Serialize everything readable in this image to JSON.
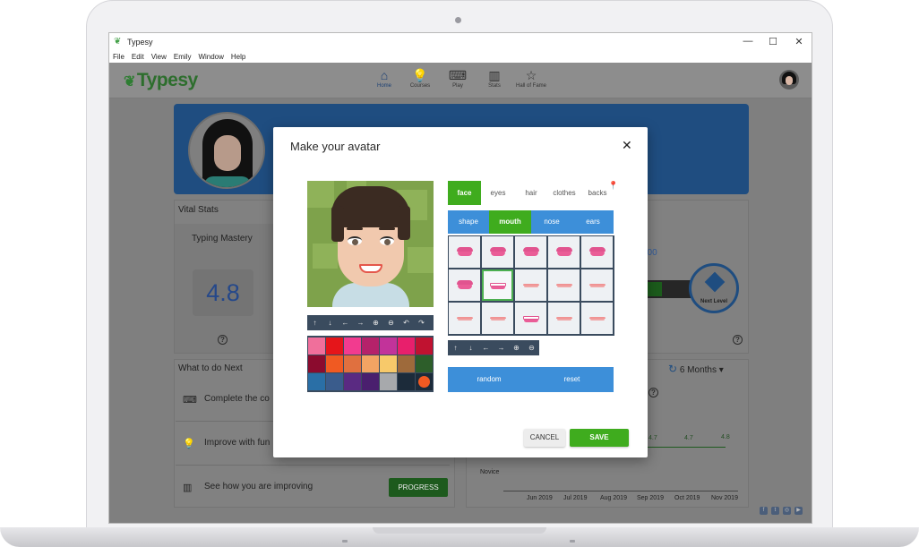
{
  "window": {
    "title": "Typesy",
    "minimize": "—",
    "maximize": "☐",
    "close": "✕"
  },
  "menu": [
    "File",
    "Edit",
    "View",
    "Emily",
    "Window",
    "Help"
  ],
  "app": {
    "logo": "Typesy"
  },
  "nav": [
    {
      "label": "Home",
      "icon": "⌂",
      "active": true
    },
    {
      "label": "Courses",
      "icon": "💡"
    },
    {
      "label": "Play",
      "icon": "⌨"
    },
    {
      "label": "Stats",
      "icon": "▥"
    },
    {
      "label": "Hall of Fame",
      "icon": "☆"
    }
  ],
  "dashboard": {
    "vital_stats_title": "Vital Stats",
    "typing_mastery_label": "Typing Mastery",
    "typing_mastery_value": "4.8",
    "level_value_partial": "000",
    "next_level_label": "Next Level",
    "what_next_title": "What to do Next",
    "todo": [
      {
        "icon": "⌨",
        "text": "Complete the co"
      },
      {
        "icon": "💡",
        "text": "Improve with fun"
      },
      {
        "icon": "▥",
        "text": "See how you are improving"
      }
    ],
    "progress_button": "PROGRESS",
    "months_filter": "6 Months",
    "chart_novice_label": "Novice",
    "chart_values": [
      "4.7",
      "4.7",
      "4.8"
    ],
    "months": [
      "Jun 2019",
      "Jul 2019",
      "Aug 2019",
      "Sep 2019",
      "Oct 2019",
      "Nov 2019"
    ]
  },
  "modal": {
    "title": "Make your avatar",
    "close": "✕",
    "tabs": [
      "face",
      "eyes",
      "hair",
      "clothes",
      "backs"
    ],
    "active_tab": "face",
    "subtabs": [
      "shape",
      "mouth",
      "nose",
      "ears"
    ],
    "active_subtab": "mouth",
    "avatar_tools": [
      "↑",
      "↓",
      "←",
      "→",
      "⊕",
      "⊖",
      "↶",
      "↷"
    ],
    "feature_tools": [
      "↑",
      "↓",
      "←",
      "→",
      "⊕",
      "⊖"
    ],
    "palette": [
      "#f06f9b",
      "#e5151a",
      "#f23b8f",
      "#b5226a",
      "#c2339a",
      "#e81f6c",
      "#c01230",
      "#8b0b2e",
      "#f05a22",
      "#e0703f",
      "#f2a463",
      "#f7c96a",
      "#9e6a3b",
      "#2d5e2a",
      "#2a6fa6",
      "#3a5c8c",
      "#5a2a82",
      "#4a1f6e",
      "#a7a9ac",
      "#1c2b3a",
      "#f25a22"
    ],
    "random_button": "random",
    "reset_button": "reset",
    "cancel_button": "CANCEL",
    "save_button": "SAVE"
  }
}
